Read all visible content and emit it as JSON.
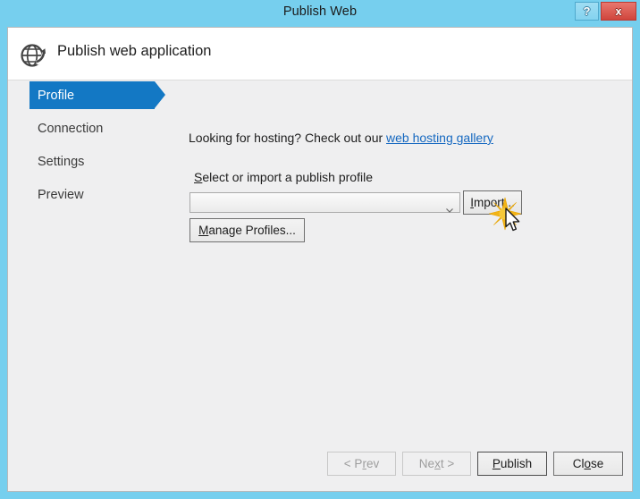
{
  "window": {
    "title": "Publish Web",
    "help_button_label": "?",
    "close_button_label": "x",
    "accent_blue": "#76cfee",
    "close_red": "#d0453c"
  },
  "header": {
    "title": "Publish web application",
    "icon": "globe-publish-icon"
  },
  "sidebar": {
    "selected_color": "#1378c4",
    "items": [
      {
        "label": "Profile",
        "selected": true
      },
      {
        "label": "Connection",
        "selected": false
      },
      {
        "label": "Settings",
        "selected": false
      },
      {
        "label": "Preview",
        "selected": false
      }
    ]
  },
  "main": {
    "hosting_prompt_prefix": "Looking for hosting? Check out our ",
    "hosting_link_text": "web hosting gallery",
    "hosting_link_color": "#1568c0",
    "profile_label_accel": "S",
    "profile_label_rest": "elect or import a publish profile",
    "profile_combo": {
      "value": "",
      "placeholder": "",
      "chevron": "chevron-down-icon"
    },
    "import_button": {
      "accel": "I",
      "rest": "mport..."
    },
    "manage_button": {
      "accel": "M",
      "rest": "anage Profiles..."
    },
    "click_indicator": "click-burst-icon",
    "cursor": "arrow-cursor-icon"
  },
  "footer": {
    "buttons": [
      {
        "prefix": "< P",
        "accel": "r",
        "suffix": "ev",
        "state": "disabled"
      },
      {
        "prefix": "Ne",
        "accel": "x",
        "suffix": "t >",
        "state": "disabled"
      },
      {
        "prefix": "",
        "accel": "P",
        "suffix": "ublish",
        "state": "default"
      },
      {
        "prefix": "Cl",
        "accel": "o",
        "suffix": "se",
        "state": "normal"
      }
    ]
  }
}
